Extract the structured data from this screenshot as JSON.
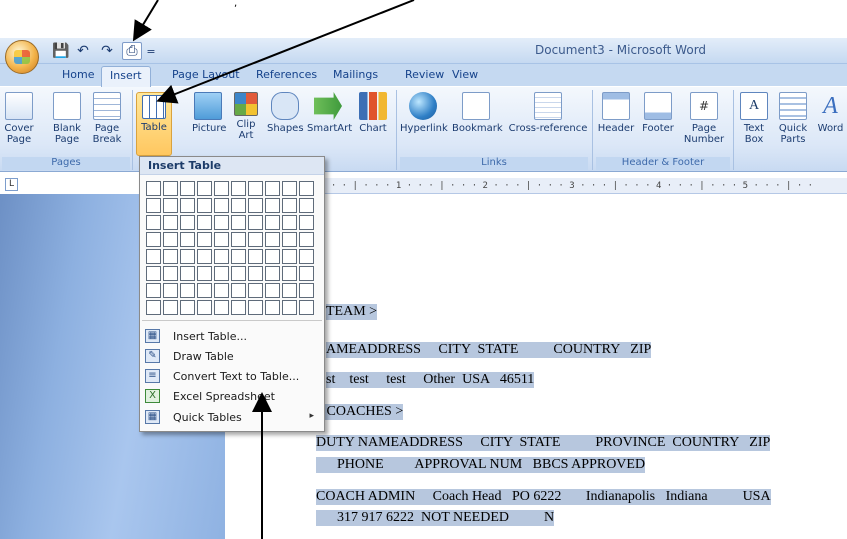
{
  "window": {
    "title": "Document3 - Microsoft Word"
  },
  "quick_access": {
    "save_icon": "save-icon",
    "undo_icon": "undo-icon",
    "redo_icon": "redo-icon",
    "print_icon": "print-icon",
    "more": "="
  },
  "tabs": [
    "Home",
    "Insert",
    "Page Layout",
    "References",
    "Mailings",
    "Review",
    "View"
  ],
  "active_tab": "Insert",
  "ribbon": {
    "pages": {
      "cover": "Cover Page",
      "blank": "Blank Page",
      "break": "Page Break",
      "group": "Pages"
    },
    "table": "Table",
    "picture": "Picture",
    "clipart": "Clip Art",
    "shapes": "Shapes",
    "smartart": "SmartArt",
    "chart": "Chart",
    "links": {
      "hyperlink": "Hyperlink",
      "bookmark": "Bookmark",
      "cross": "Cross-reference",
      "group": "Links"
    },
    "hf": {
      "header": "Header",
      "footer": "Footer",
      "pagenum": "Page Number",
      "group": "Header & Footer"
    },
    "text": {
      "textbox": "Text Box",
      "quickparts": "Quick Parts",
      "wordart": "Word"
    }
  },
  "ruler": {
    "marks": "· · · | · · · 1 · · · | · · · 2 · · · | · · · 3 · · · | · · · 4 · · · | · · · 5 · · · | · ·"
  },
  "dropdown": {
    "header": "Insert Table",
    "rows": 8,
    "cols": 10,
    "items": [
      {
        "label": "Insert Table...",
        "icon": "table-icon"
      },
      {
        "label": "Draw Table",
        "icon": "pencil-icon"
      },
      {
        "label": "Convert Text to Table...",
        "icon": "convert-icon"
      },
      {
        "label": "Excel Spreadsheet",
        "icon": "excel-icon"
      },
      {
        "label": "Quick Tables",
        "icon": "quick-tables-icon",
        "submenu": "▸"
      }
    ]
  },
  "document": {
    "lines": [
      "TEAM >",
      "AMEADDRESS     CITY  STATE          COUNTRY   ZIP",
      "st    test     test     Other  USA   46511",
      " COACHES >",
      "DUTY NAMEADDRESS     CITY  STATE          PROVINCE  COUNTRY   ZIP",
      "      PHONE         APPROVAL NUM   BBCS APPROVED",
      "COACH ADMIN     Coach Head   PO 6222       Indianapolis   Indiana          USA",
      "      317 917 6222  NOT NEEDED          N"
    ]
  },
  "colors": {
    "accent": "#15428b",
    "highlight": "#b7c7de",
    "table_button": "#ffc760"
  }
}
